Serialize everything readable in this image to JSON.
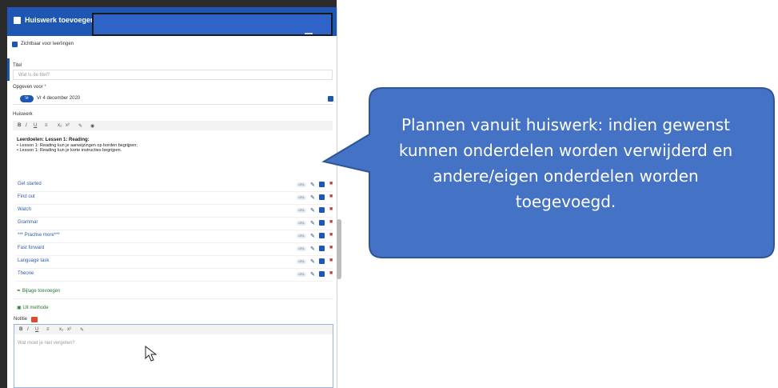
{
  "header": {
    "title": "Huiswerk toevoegen"
  },
  "visibility": {
    "label": "Zichtbaar voor leerlingen"
  },
  "title_field": {
    "label": "Titel",
    "placeholder": "Wat is de titel?"
  },
  "due": {
    "label": "Opgeven voor",
    "required_mark": "*",
    "day": "Vr",
    "date": "Vr 4 december 2020"
  },
  "homework": {
    "label": "Huiswerk",
    "toolbar": [
      "B",
      "I",
      "U",
      "≡",
      "x₂",
      "x²",
      "✎",
      "◉"
    ],
    "content_heading": "Leerdoelen: Lessen 1: Reading:",
    "bullets": [
      "Lesson 1: Reading kun je aanwijzingen op borden begrijpen;",
      "Lesson 1: Reading kun je korte instructies begrijpen."
    ]
  },
  "items": [
    {
      "label": "Get started",
      "tag": "URL"
    },
    {
      "label": "Find out",
      "tag": "URL"
    },
    {
      "label": "Watch",
      "tag": "URL"
    },
    {
      "label": "Grammar",
      "tag": "URL"
    },
    {
      "label": "*** Practise more***",
      "tag": "URL"
    },
    {
      "label": "Fast forward",
      "tag": "URL"
    },
    {
      "label": "Language task",
      "tag": "URL"
    },
    {
      "label": "Theorie",
      "tag": "URL"
    }
  ],
  "actions": {
    "add_attachment": "Bijlage toevoegen",
    "from_method": "Uit methode"
  },
  "note": {
    "label": "Notitie",
    "toolbar": [
      "B",
      "I",
      "U",
      "≡",
      "x₂",
      "x²",
      "✎"
    ],
    "placeholder": "Wat moet je niet vergeten?"
  },
  "callout": {
    "text": "Plannen vanuit huiswerk: indien gewenst kunnen onderdelen worden verwijderd en andere/eigen onderdelen worden toegevoegd.",
    "fill": "#4472c4",
    "stroke": "#2f5597"
  },
  "colors": {
    "accent": "#1e56b3",
    "delete": "#d23b2b",
    "action_green": "#2a7a35"
  }
}
